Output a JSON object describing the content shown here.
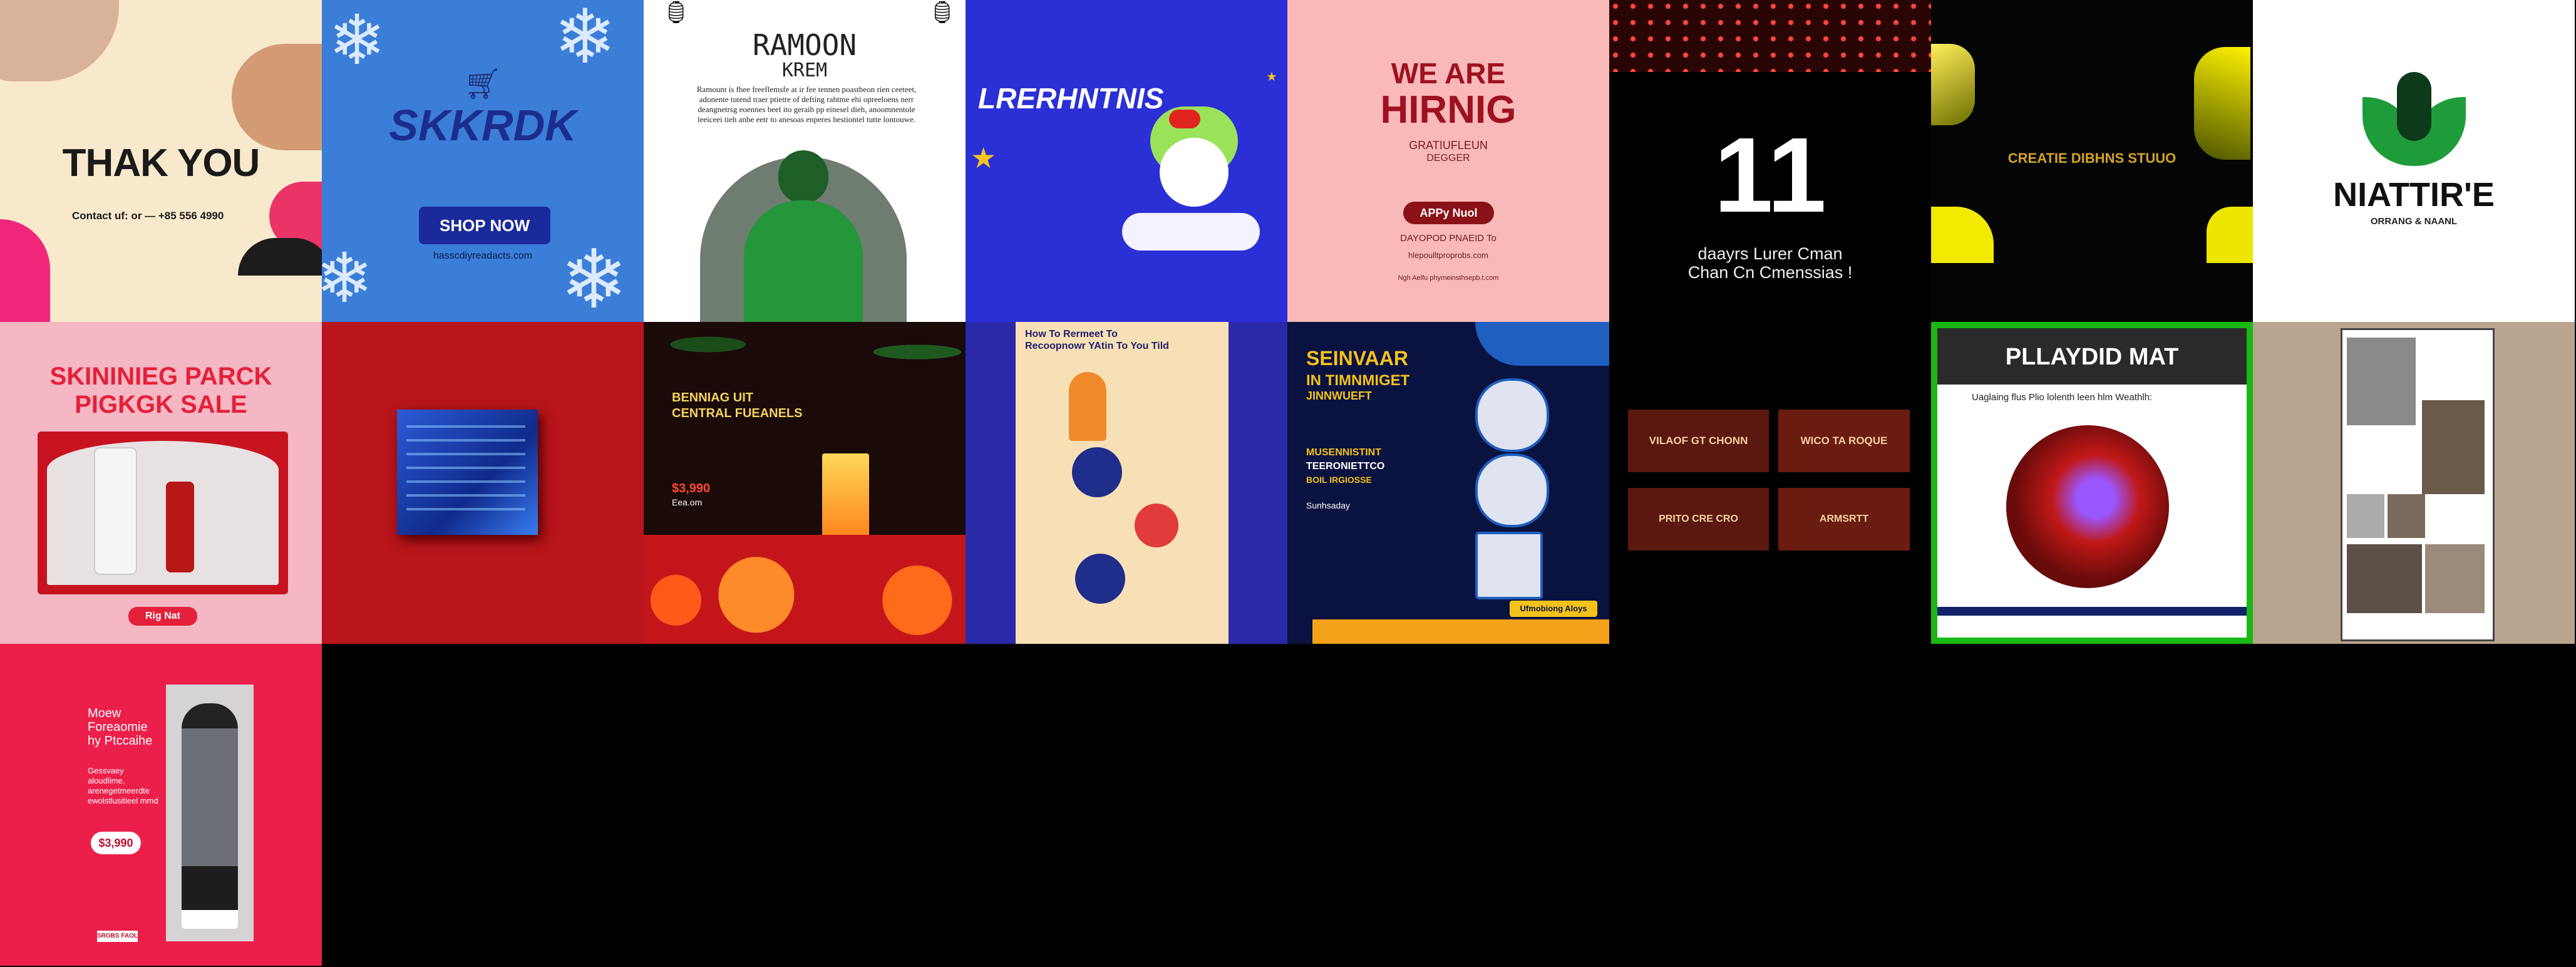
{
  "tiles": {
    "t1": {
      "headline": "THAK YOU",
      "contact": "Contact uf: or — +85 556 4990"
    },
    "t2": {
      "brand": "SKKRDK",
      "button": "SHOP NOW",
      "url": "hasscdiyreadacts.com"
    },
    "t3": {
      "title1": "RAMOON",
      "title2": "KREM",
      "body": "Ramount is fhee freeflemsfe at ir fee tennen poastbeon rien ceeteet, adonente tutend traer ptietre of defting rahtme ehi opreeloens nerr deangnetrsg eoennes beel ito geraib pp einesel dieh, anoomnentole leeiceei tieh anbe eetr to anesoas enperes hestiontel tutte lontouwe."
    },
    "t4": {
      "title": "LRERHNTNIS"
    },
    "t5": {
      "line1": "WE ARE",
      "line2": "HIRNIG",
      "role1": "GRATIUFLEUN",
      "role2": "DEGGER",
      "button": "APPy Nuol",
      "phone": "DAYOPOD PNAEID To",
      "email": "hlepoulltproprobs.com",
      "footer": "Ngh Aelfu phymeinsthsepb.t.com"
    },
    "t6": {
      "number": "11",
      "line1": "daayrs Lurer Cman",
      "line2": "Chan Cn Cmenssias !"
    },
    "t7": {
      "text": "CREATIE DIBHNS STUUO"
    },
    "t8": {
      "brand": "NIATTIR'E",
      "sub": "ORRANG & NAANL"
    },
    "t9": {
      "title1": "SKININIEG PARCK",
      "title2": "PIGKGK SALE",
      "button": "Rig Nat"
    },
    "t11": {
      "title1": "BENNIAG UIT",
      "title2": "CENTRAL FUEANELS",
      "price": "$3,990",
      "note": "Eea.om"
    },
    "t12": {
      "title": "How To Rermeet To Recoopnowr YAtin To You Tild"
    },
    "t13": {
      "title1": "SEINVAAR",
      "title2": "IN TIMNMIGET",
      "title3": "JINNWUEFT",
      "sub1": "MUSENNISTINT",
      "sub2": "TEERONIETTCO",
      "sub3": "BOIL IRGIOSSE",
      "date": "Sunhsaday",
      "cta": "Ufmobiong Aloys"
    },
    "t14": {
      "card1": "VILAOF GT CHONN",
      "card2": "WICO TA ROQUE",
      "card3": "PRITO CRE CRO",
      "card4": "ARMSRTT"
    },
    "t15": {
      "title": "PLLAYDID MAT",
      "sub": "Uaglaing flus Plio lolenth leen hlm Weathlh:"
    },
    "t17": {
      "title1": "Moew",
      "title2": "Foreaomie",
      "title3": "hy Ptccaihe",
      "body": "Gessvaey aloudlime, arenegetmeerdte ewolstlusitieel mmd",
      "price": "$3,990",
      "small": "SRGBS FAOL"
    }
  },
  "colors": {
    "pink_bg": "#f8a5ac",
    "red_bg": "#b8151c",
    "blue_bg": "#2b2fd6",
    "cream_bg": "#f7e7c6",
    "navy_bg": "#0a1240"
  }
}
